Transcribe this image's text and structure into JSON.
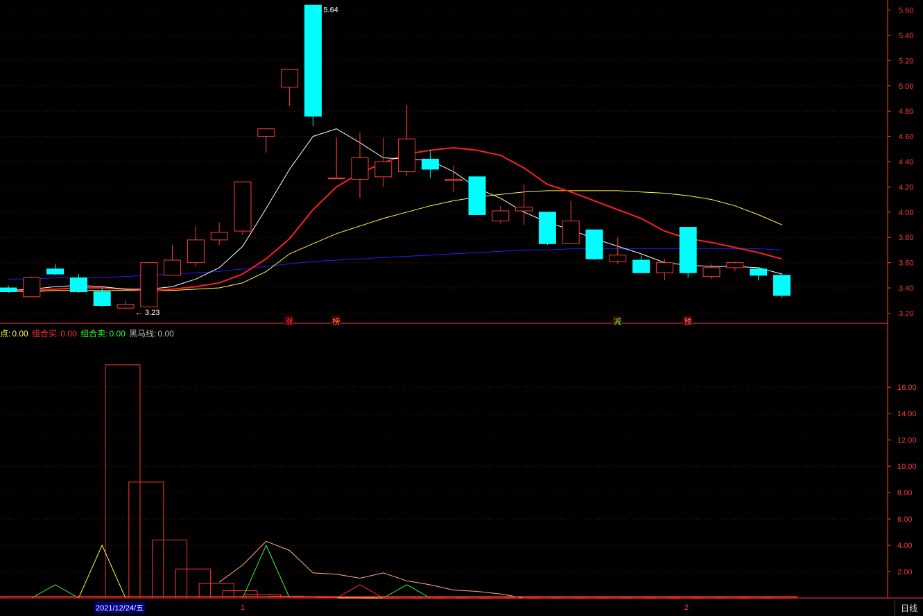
{
  "legend": {
    "a_label": "点:",
    "a_value": "0.00",
    "buy_label": "组合买:",
    "buy_value": "0.00",
    "sell_label": "组合卖:",
    "sell_value": "0.00",
    "horse_label": "黑马线:",
    "horse_value": "0.00"
  },
  "bottom": {
    "date_label": "2021/12/24/五",
    "period": "日线",
    "month_marks": [
      "1",
      "2"
    ]
  },
  "colors": {
    "up": "#ff3b3b",
    "down": "#00ffff",
    "ma5": "#ffffff",
    "ma10": "#ff2020",
    "ma20": "#ffff40",
    "ma60": "#2020ff",
    "grid": "#8b0000",
    "axis": "#ff3b3b"
  },
  "chart_data": {
    "type": "candlestick",
    "price_axis": {
      "ylim": [
        3.12,
        5.68
      ],
      "ticks": [
        "5.60",
        "5.40",
        "5.20",
        "5.00",
        "4.80",
        "4.60",
        "4.40",
        "4.20",
        "4.00",
        "3.80",
        "3.60",
        "3.40",
        "3.20"
      ]
    },
    "annotations": {
      "high": "5.64",
      "low": "3.23"
    },
    "markers": [
      "涨",
      "榜",
      "减",
      "预"
    ],
    "candles": [
      {
        "o": 3.4,
        "c": 3.37,
        "h": 3.42,
        "l": 3.36
      },
      {
        "o": 3.33,
        "c": 3.48,
        "h": 3.49,
        "l": 3.33
      },
      {
        "o": 3.55,
        "c": 3.51,
        "h": 3.59,
        "l": 3.5
      },
      {
        "o": 3.48,
        "c": 3.37,
        "h": 3.51,
        "l": 3.36
      },
      {
        "o": 3.37,
        "c": 3.26,
        "h": 3.4,
        "l": 3.25
      },
      {
        "o": 3.24,
        "c": 3.27,
        "h": 3.3,
        "l": 3.23
      },
      {
        "o": 3.25,
        "c": 3.6,
        "h": 3.6,
        "l": 3.25
      },
      {
        "o": 3.5,
        "c": 3.62,
        "h": 3.74,
        "l": 3.5
      },
      {
        "o": 3.6,
        "c": 3.78,
        "h": 3.89,
        "l": 3.57
      },
      {
        "o": 3.78,
        "c": 3.84,
        "h": 3.92,
        "l": 3.74
      },
      {
        "o": 3.85,
        "c": 4.24,
        "h": 4.24,
        "l": 3.82
      },
      {
        "o": 4.6,
        "c": 4.66,
        "h": 4.66,
        "l": 4.47
      },
      {
        "o": 4.99,
        "c": 5.13,
        "h": 5.13,
        "l": 4.84
      },
      {
        "o": 5.64,
        "c": 4.76,
        "h": 5.64,
        "l": 4.68
      },
      {
        "o": 4.27,
        "c": 4.27,
        "h": 4.59,
        "l": 4.27
      },
      {
        "o": 4.26,
        "c": 4.43,
        "h": 4.63,
        "l": 4.11
      },
      {
        "o": 4.28,
        "c": 4.4,
        "h": 4.59,
        "l": 4.2
      },
      {
        "o": 4.32,
        "c": 4.58,
        "h": 4.85,
        "l": 4.29
      },
      {
        "o": 4.42,
        "c": 4.34,
        "h": 4.49,
        "l": 4.27
      },
      {
        "o": 4.25,
        "c": 4.26,
        "h": 4.37,
        "l": 4.16
      },
      {
        "o": 4.28,
        "c": 3.98,
        "h": 4.28,
        "l": 3.98
      },
      {
        "o": 3.93,
        "c": 4.01,
        "h": 4.05,
        "l": 3.91
      },
      {
        "o": 4.01,
        "c": 4.04,
        "h": 4.22,
        "l": 3.9
      },
      {
        "o": 4.0,
        "c": 3.75,
        "h": 4.0,
        "l": 3.74
      },
      {
        "o": 3.75,
        "c": 3.93,
        "h": 4.09,
        "l": 3.75
      },
      {
        "o": 3.86,
        "c": 3.63,
        "h": 3.86,
        "l": 3.62
      },
      {
        "o": 3.61,
        "c": 3.66,
        "h": 3.8,
        "l": 3.59
      },
      {
        "o": 3.62,
        "c": 3.52,
        "h": 3.66,
        "l": 3.52
      },
      {
        "o": 3.52,
        "c": 3.6,
        "h": 3.63,
        "l": 3.46
      },
      {
        "o": 3.88,
        "c": 3.52,
        "h": 3.88,
        "l": 3.48
      },
      {
        "o": 3.49,
        "c": 3.56,
        "h": 3.59,
        "l": 3.47
      },
      {
        "o": 3.56,
        "c": 3.6,
        "h": 3.61,
        "l": 3.53
      },
      {
        "o": 3.55,
        "c": 3.5,
        "h": 3.56,
        "l": 3.46
      },
      {
        "o": 3.5,
        "c": 3.34,
        "h": 3.52,
        "l": 3.32
      }
    ],
    "ma5": [
      3.38,
      3.39,
      3.41,
      3.42,
      3.41,
      3.39,
      3.39,
      3.41,
      3.47,
      3.56,
      3.73,
      4.03,
      4.34,
      4.6,
      4.66,
      4.55,
      4.43,
      4.42,
      4.41,
      4.32,
      4.19,
      4.11,
      4.0,
      3.92,
      3.86,
      3.79,
      3.73,
      3.67,
      3.6,
      3.58,
      3.57,
      3.57,
      3.56,
      3.51
    ],
    "ma10": [
      3.37,
      3.38,
      3.39,
      3.4,
      3.4,
      3.39,
      3.38,
      3.39,
      3.41,
      3.44,
      3.51,
      3.63,
      3.79,
      4.02,
      4.2,
      4.31,
      4.39,
      4.46,
      4.49,
      4.51,
      4.49,
      4.45,
      4.35,
      4.22,
      4.16,
      4.09,
      4.02,
      3.95,
      3.85,
      3.79,
      3.76,
      3.72,
      3.68,
      3.63
    ],
    "ma20": [
      3.37,
      3.37,
      3.38,
      3.38,
      3.38,
      3.38,
      3.38,
      3.38,
      3.39,
      3.4,
      3.44,
      3.53,
      3.67,
      3.75,
      3.83,
      3.89,
      3.95,
      4.0,
      4.05,
      4.09,
      4.12,
      4.14,
      4.16,
      4.17,
      4.17,
      4.17,
      4.17,
      4.16,
      4.15,
      4.13,
      4.1,
      4.05,
      3.98,
      3.9
    ],
    "ma60": [
      3.47,
      3.47,
      3.48,
      3.48,
      3.48,
      3.49,
      3.5,
      3.51,
      3.52,
      3.53,
      3.55,
      3.57,
      3.59,
      3.61,
      3.62,
      3.63,
      3.64,
      3.65,
      3.66,
      3.67,
      3.68,
      3.69,
      3.7,
      3.7,
      3.71,
      3.71,
      3.71,
      3.71,
      3.71,
      3.71,
      3.71,
      3.71,
      3.71,
      3.7
    ],
    "lower": {
      "ylim": [
        0,
        19.8
      ],
      "ticks": [
        "16.00",
        "14.00",
        "12.00",
        "10.00",
        "8.00",
        "6.00",
        "4.00",
        "2.00"
      ],
      "bars": [
        0.1,
        0.1,
        0.1,
        0.1,
        0.1,
        17.7,
        8.8,
        4.4,
        2.2,
        1.1,
        0.55,
        0.27,
        0.14,
        0.07,
        0.03,
        0.02,
        0.01,
        0.01,
        0.01,
        0.01,
        0.01,
        0.01,
        0.01,
        0.01,
        0.01,
        0.01,
        0.01,
        0.01,
        0.01,
        0.01,
        0.01,
        0.01,
        0.01,
        0.01
      ],
      "line_orange": [
        null,
        null,
        null,
        null,
        null,
        null,
        null,
        null,
        null,
        1.2,
        2.5,
        4.3,
        3.6,
        1.9,
        1.8,
        1.5,
        1.9,
        1.3,
        1.0,
        0.6,
        0.5,
        0.3,
        0.0,
        0.0,
        0.0,
        0.0,
        0.0,
        0.0,
        0.0,
        0.0,
        0.0,
        0.0,
        0.0,
        0.0
      ],
      "line_green": [
        0.0,
        0.0,
        1.0,
        0.0,
        0.0,
        0.0,
        0.0,
        0.0,
        0.0,
        0.0,
        0.0,
        4.0,
        0.0,
        0.0,
        0.0,
        0.0,
        0.0,
        1.0,
        0.0,
        0.0,
        0.0,
        0.0,
        0.0,
        0.0,
        0.0,
        0.0,
        0.0,
        0.0,
        0.0,
        0.0,
        0.0,
        0.0,
        0.0,
        0.0
      ],
      "line_yellow": [
        0.0,
        0.0,
        0.0,
        0.0,
        4.0,
        0.0,
        0.0,
        0.0,
        0.0,
        0.0,
        0.0,
        0.0,
        0.0,
        0.0,
        0.0,
        0.0,
        0.0,
        0.0,
        0.0,
        0.0,
        0.0,
        0.0,
        0.0,
        0.0,
        0.0,
        0.0,
        0.0,
        0.0,
        0.0,
        0.0,
        0.0,
        0.0,
        0.0,
        0.0
      ],
      "line_red": [
        0.0,
        0.0,
        0.0,
        0.0,
        0.0,
        0.0,
        0.0,
        0.0,
        0.0,
        0.0,
        0.0,
        0.0,
        0.0,
        0.0,
        0.0,
        1.0,
        0.0,
        0.0,
        0.0,
        0.0,
        0.0,
        0.0,
        0.0,
        0.0,
        0.0,
        0.0,
        0.0,
        0.0,
        0.0,
        0.0,
        0.0,
        0.0,
        0.0,
        0.0
      ]
    }
  }
}
